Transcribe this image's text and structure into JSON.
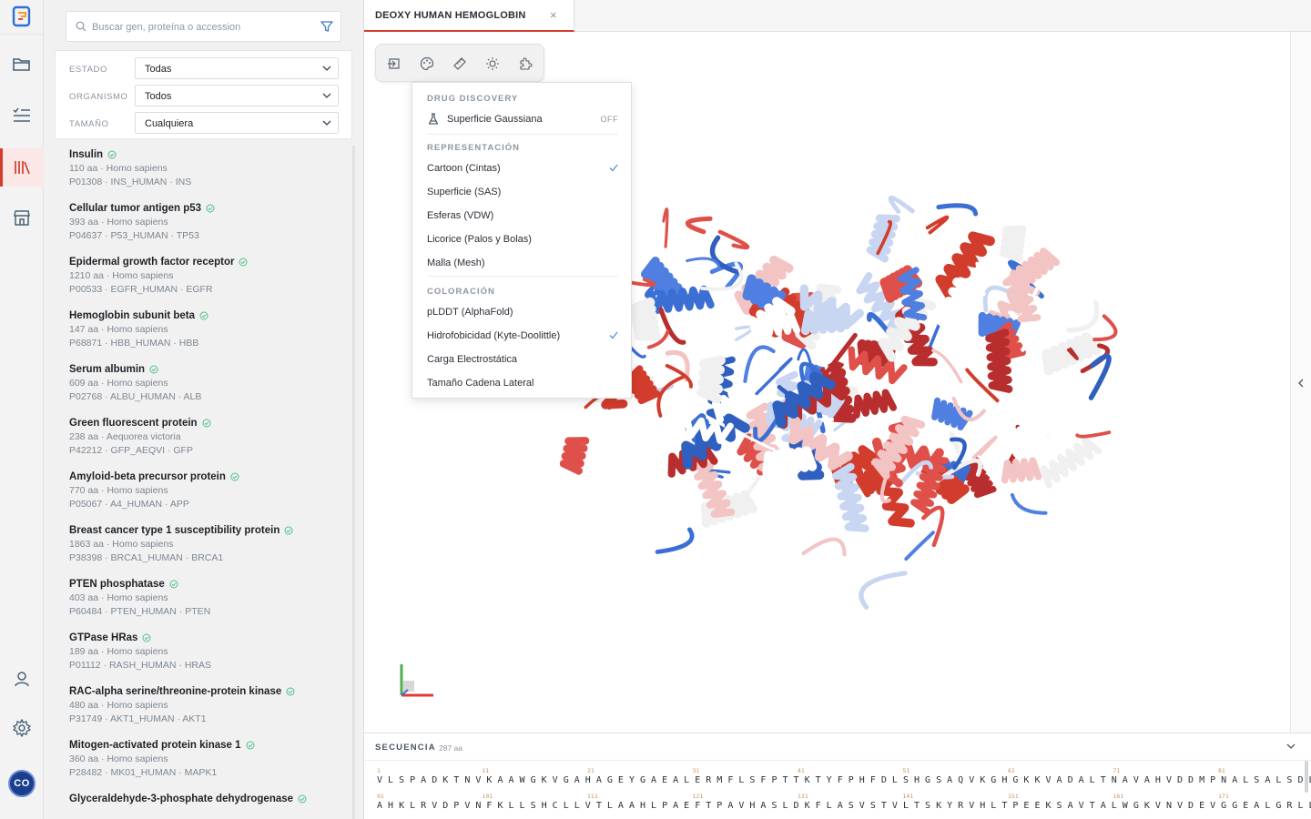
{
  "rail": {
    "items": [
      {
        "icon": "folder-icon"
      },
      {
        "icon": "checklist-icon"
      },
      {
        "icon": "library-icon",
        "active": true
      },
      {
        "icon": "store-icon"
      }
    ],
    "bottom": [
      {
        "icon": "user-icon"
      },
      {
        "icon": "gear-icon"
      }
    ],
    "avatar_initials": "CO"
  },
  "library": {
    "search_placeholder": "Buscar gen, proteína o accession",
    "filters": [
      {
        "label": "ESTADO",
        "value": "Todas"
      },
      {
        "label": "ORGANISMO",
        "value": "Todos"
      },
      {
        "label": "TAMAÑO",
        "value": "Cualquiera"
      }
    ],
    "proteins": [
      {
        "name": "Insulin",
        "meta": "110 aa · Homo sapiens",
        "ids": "P01308 · INS_HUMAN · INS"
      },
      {
        "name": "Cellular tumor antigen p53",
        "meta": "393 aa · Homo sapiens",
        "ids": "P04637 · P53_HUMAN · TP53"
      },
      {
        "name": "Epidermal growth factor receptor",
        "meta": "1210 aa · Homo sapiens",
        "ids": "P00533 · EGFR_HUMAN · EGFR"
      },
      {
        "name": "Hemoglobin subunit beta",
        "meta": "147 aa · Homo sapiens",
        "ids": "P68871 · HBB_HUMAN · HBB"
      },
      {
        "name": "Serum albumin",
        "meta": "609 aa · Homo sapiens",
        "ids": "P02768 · ALBU_HUMAN · ALB"
      },
      {
        "name": "Green fluorescent protein",
        "meta": "238 aa · Aequorea victoria",
        "ids": "P42212 · GFP_AEQVI · GFP"
      },
      {
        "name": "Amyloid-beta precursor protein",
        "meta": "770 aa · Homo sapiens",
        "ids": "P05067 · A4_HUMAN · APP"
      },
      {
        "name": "Breast cancer type 1 susceptibility protein",
        "meta": "1863 aa · Homo sapiens",
        "ids": "P38398 · BRCA1_HUMAN · BRCA1"
      },
      {
        "name": "PTEN phosphatase",
        "meta": "403 aa · Homo sapiens",
        "ids": "P60484 · PTEN_HUMAN · PTEN"
      },
      {
        "name": "GTPase HRas",
        "meta": "189 aa · Homo sapiens",
        "ids": "P01112 · RASH_HUMAN · HRAS"
      },
      {
        "name": "RAC-alpha serine/threonine-protein kinase",
        "meta": "480 aa · Homo sapiens",
        "ids": "P31749 · AKT1_HUMAN · AKT1"
      },
      {
        "name": "Mitogen-activated protein kinase 1",
        "meta": "360 aa · Homo sapiens",
        "ids": "P28482 · MK01_HUMAN · MAPK1"
      },
      {
        "name": "Glyceraldehyde-3-phosphate dehydrogenase",
        "meta": "",
        "ids": ""
      }
    ]
  },
  "tab": {
    "label": "DEOXY HUMAN HEMOGLOBIN",
    "close": "×"
  },
  "toolbar": {
    "buttons": [
      "import-icon",
      "palette-icon",
      "measure-icon",
      "lighting-icon",
      "plugin-icon"
    ]
  },
  "menu": {
    "drug_discovery": {
      "title": "DRUG DISCOVERY",
      "item": "Superficie Gaussiana",
      "state": "OFF"
    },
    "representation": {
      "title": "REPRESENTACIÓN",
      "items": [
        "Cartoon (Cintas)",
        "Superficie (SAS)",
        "Esferas (VDW)",
        "Licorice (Palos y Bolas)",
        "Malla (Mesh)"
      ],
      "selected": 0
    },
    "coloring": {
      "title": "COLORACIÓN",
      "items": [
        "pLDDT (AlphaFold)",
        "Hidrofobicidad (Kyte-Doolittle)",
        "Carga Electrostática",
        "Tamaño Cadena Lateral"
      ],
      "selected": 1
    }
  },
  "colors": {
    "accent": "#d23c2c",
    "hydrophobic": "#d23c2c",
    "hydrophilic": "#3b6fd4",
    "neutral": "#f0f0f0",
    "check": "#5b8ed6"
  },
  "sequence": {
    "title": "SECUENCIA",
    "count": "287 aa",
    "rows": [
      {
        "markers": [
          "1",
          "11",
          "21",
          "31",
          "41",
          "51",
          "61",
          "71",
          "81"
        ],
        "residues": "VLSPADKTNVKAAWGKVGAHAGEYGAEALERMFLSFPTTKTYFPHFDLSHGSAQVKGHGKKVADALTNAVAHVDDMPNALSALSDLH"
      },
      {
        "markers": [
          "91",
          "101",
          "111",
          "121",
          "131",
          "141",
          "151",
          "161",
          "171"
        ],
        "residues": "AHKLRVDPVNFKLLSHCLLVTLAAHLPAEFTPAVHASLDKFLASVSTVLTSKYRVHLTPEEKSAVTALWGKVNVDEVGGEALGRLLV"
      }
    ]
  }
}
